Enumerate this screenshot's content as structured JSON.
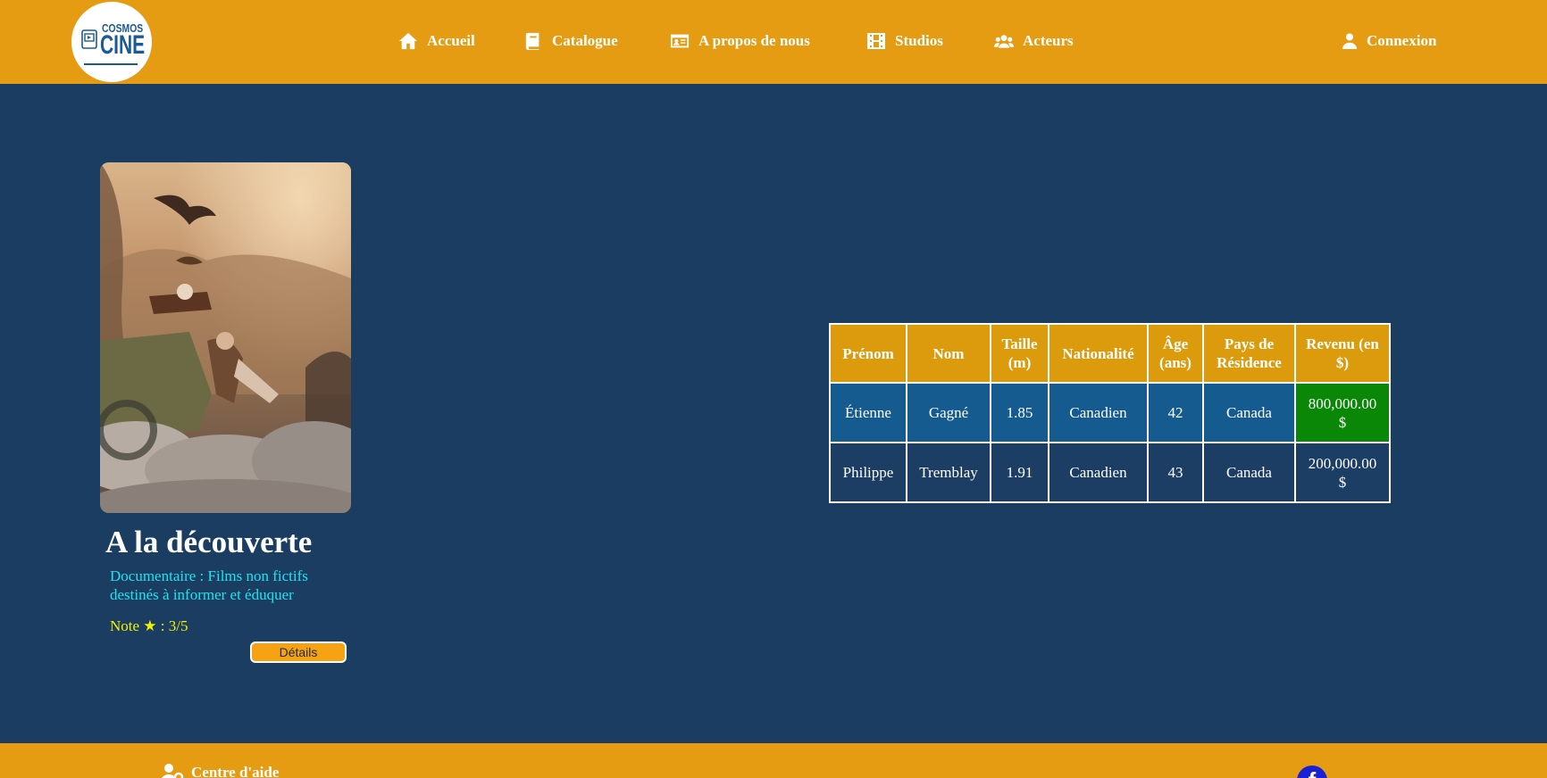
{
  "header": {
    "logo": {
      "top_text": "COSMOS",
      "bottom_text": "CINE"
    },
    "nav": [
      {
        "label": "Accueil",
        "icon": "home-icon"
      },
      {
        "label": "Catalogue",
        "icon": "book-icon"
      },
      {
        "label": "A propos de nous",
        "icon": "id-card-icon"
      },
      {
        "label": "Studios",
        "icon": "film-icon"
      },
      {
        "label": "Acteurs",
        "icon": "users-icon"
      }
    ],
    "login": {
      "label": "Connexion",
      "icon": "user-icon"
    }
  },
  "movie": {
    "title": "A la découverte",
    "genre": "Documentaire : Films non fictifs destinés à informer et éduquer",
    "rating_text": "Note ★ : 3/5",
    "details_label": "Détails"
  },
  "table": {
    "headers": [
      "Prénom",
      "Nom",
      "Taille (m)",
      "Nationalité",
      "Âge (ans)",
      "Pays de Résidence",
      "Revenu (en $)"
    ],
    "rows": [
      [
        "Étienne",
        "Gagné",
        "1.85",
        "Canadien",
        "42",
        "Canada",
        "800,000.00 $"
      ],
      [
        "Philippe",
        "Tremblay",
        "1.91",
        "Canadien",
        "43",
        "Canada",
        "200,000.00 $"
      ]
    ]
  },
  "footer": {
    "help_label": "Centre d'aide",
    "social_icon": "facebook-icon"
  },
  "colors": {
    "header_bg": "#e59b12",
    "page_bg": "#1b3d62",
    "table_header_bg": "#dc9b0d",
    "row1_bg": "#155b8f",
    "revenue_high_bg": "#0a8707",
    "genre_text": "#1ee4f0",
    "rating_text": "#f3f000"
  }
}
